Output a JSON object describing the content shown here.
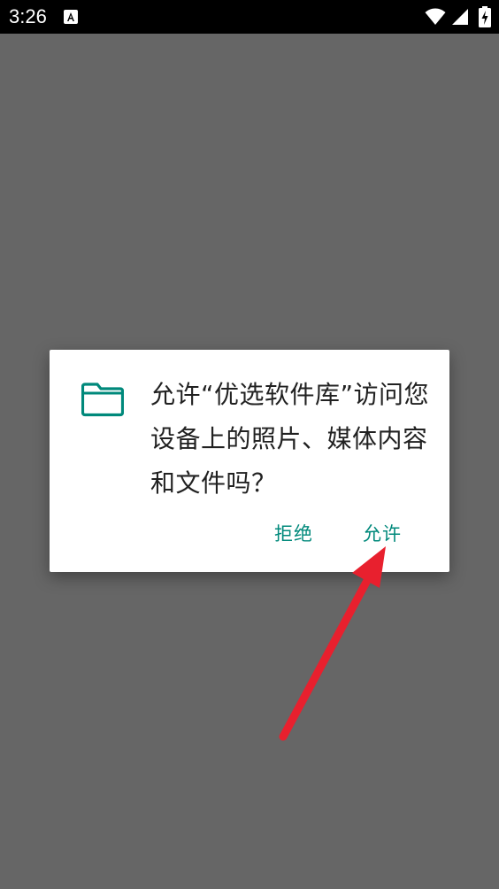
{
  "status_bar": {
    "time": "3:26",
    "icons": [
      "text-a-notification-icon",
      "wifi-icon",
      "cellular-signal-icon",
      "battery-charging-icon"
    ]
  },
  "dialog": {
    "icon": "folder-icon",
    "message": "允许“优选软件库”访问您设备上的照片、媒体内容和文件吗？",
    "deny_label": "拒绝",
    "allow_label": "允许"
  },
  "annotation": {
    "arrow_color": "#e8202e",
    "points_to": "allow-button"
  },
  "colors": {
    "accent": "#00897b",
    "dim_background": "#666666",
    "status_bar": "#000000"
  }
}
